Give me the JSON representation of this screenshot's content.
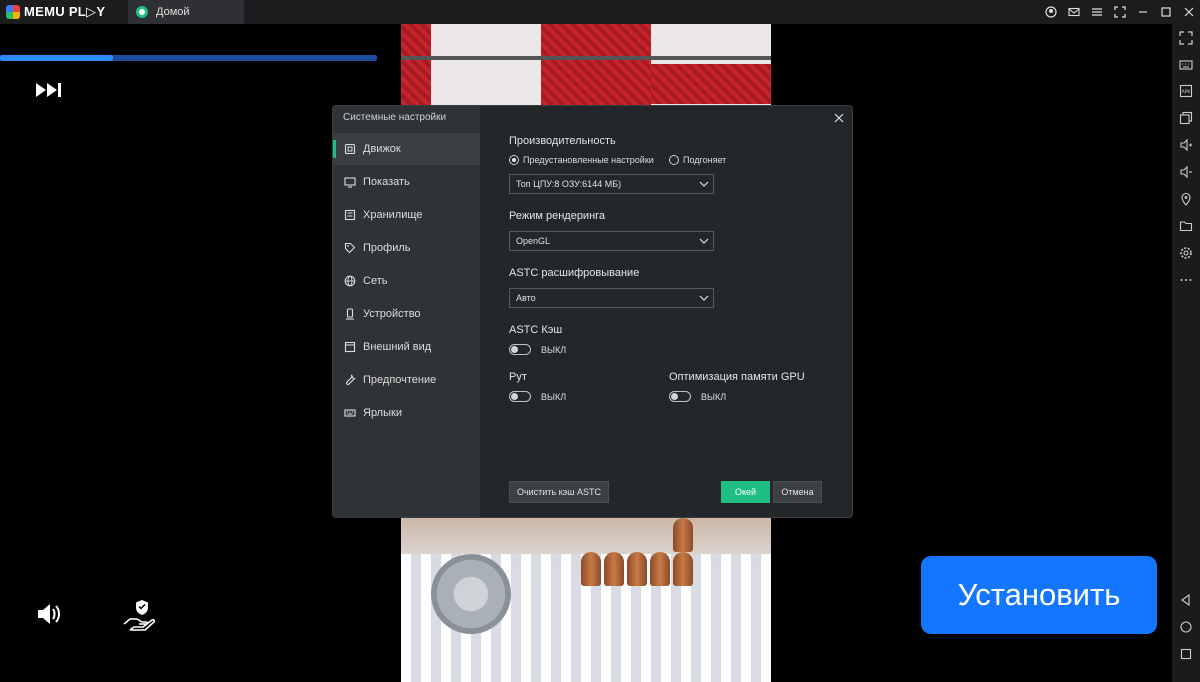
{
  "app": {
    "logo_text": "MEMU PL▷Y",
    "tab_label": "Домой"
  },
  "progress": {
    "fraction": 0.3
  },
  "install_button": "Установить",
  "modal": {
    "title": "Системные настройки",
    "nav": [
      {
        "label": "Движок",
        "icon": "chip-icon"
      },
      {
        "label": "Показать",
        "icon": "monitor-icon"
      },
      {
        "label": "Хранилище",
        "icon": "storage-icon"
      },
      {
        "label": "Профиль",
        "icon": "tag-icon"
      },
      {
        "label": "Сеть",
        "icon": "globe-icon"
      },
      {
        "label": "Устройство",
        "icon": "device-icon"
      },
      {
        "label": "Внешний вид",
        "icon": "window-icon"
      },
      {
        "label": "Предпочтение",
        "icon": "wrench-icon"
      },
      {
        "label": "Ярлыки",
        "icon": "keyboard-icon"
      }
    ],
    "performance": {
      "label": "Производительность",
      "option_preset": "Предустановленные настройки",
      "option_custom": "Подгоняет",
      "selected": "preset",
      "preset_value": "Топ ЦПУ:8 ОЗУ:6144 МБ)"
    },
    "render_mode": {
      "label": "Режим рендеринга",
      "value": "OpenGL"
    },
    "astc_decoding": {
      "label": "ASTC расшифровывание",
      "value": "Авто"
    },
    "astc_cache": {
      "label": "ASTC Кэш",
      "state": "ВЫКЛ"
    },
    "root": {
      "label": "Рут",
      "state": "ВЫКЛ"
    },
    "gpu_memory": {
      "label": "Оптимизация памяти GPU",
      "state": "ВЫКЛ"
    },
    "buttons": {
      "clear_cache": "Очистить кэш ASTC",
      "ok": "Окей",
      "cancel": "Отмена"
    }
  }
}
